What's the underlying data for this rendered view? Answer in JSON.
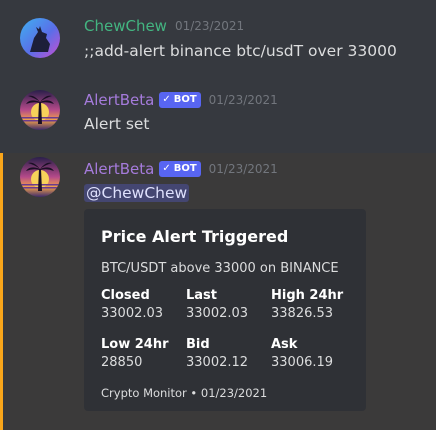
{
  "messages": [
    {
      "username": "ChewChew",
      "username_color": "#43b581",
      "timestamp": "01/23/2021",
      "text": ";;add-alert binance btc/usdT over 33000"
    },
    {
      "username": "AlertBeta",
      "username_color": "#a57bdb",
      "bot_tag": "BOT",
      "timestamp": "01/23/2021",
      "text": "Alert set"
    },
    {
      "username": "AlertBeta",
      "username_color": "#a57bdb",
      "bot_tag": "BOT",
      "timestamp": "01/23/2021",
      "mention": "@ChewChew",
      "embed": {
        "title": "Price Alert Triggered",
        "description": "BTC/USDT above 33000 on BINANCE",
        "fields": [
          {
            "name": "Closed",
            "value": "33002.03"
          },
          {
            "name": "Last",
            "value": "33002.03"
          },
          {
            "name": "High 24hr",
            "value": "33826.53"
          },
          {
            "name": "Low 24hr",
            "value": "28850"
          },
          {
            "name": "Bid",
            "value": "33002.12"
          },
          {
            "name": "Ask",
            "value": "33006.19"
          }
        ],
        "footer": "Crypto Monitor • 01/23/2021"
      }
    }
  ],
  "colors": {
    "background": "#36393f",
    "highlight_bar": "#faa61a",
    "bot_tag": "#5865f2",
    "embed_bg": "#2f3136"
  },
  "icons": {
    "bot_check": "checkmark-icon",
    "avatar_1": "wolf-avatar",
    "avatar_2": "palm-tree-sunset-avatar"
  }
}
